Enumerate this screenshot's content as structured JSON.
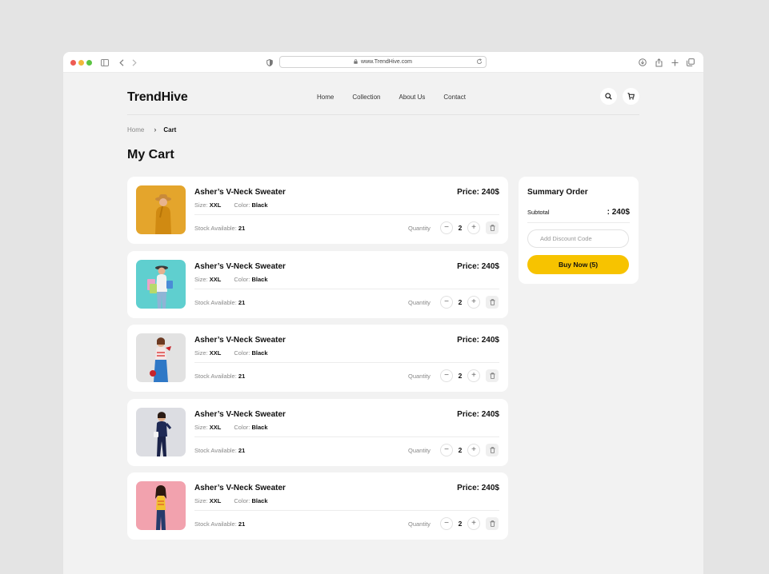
{
  "browser": {
    "url": "www.TrendHive.com"
  },
  "site": {
    "logo": "TrendHive",
    "nav": [
      {
        "label": "Home"
      },
      {
        "label": "Collection"
      },
      {
        "label": "About Us"
      },
      {
        "label": "Contact"
      }
    ]
  },
  "breadcrumb": {
    "home": "Home",
    "current": "Cart"
  },
  "page": {
    "title": "My Cart"
  },
  "cart": {
    "items": [
      {
        "name": "Asher’s V-Neck Sweater",
        "price": "Price: 240$",
        "size_label": "Size:",
        "size": "XXL",
        "color_label": "Color:",
        "color": "Black",
        "stock_label": "Stock Available:",
        "stock": "21",
        "quantity_label": "Quantity",
        "quantity": "2",
        "image_bg": "#e4a52c"
      },
      {
        "name": "Asher’s V-Neck Sweater",
        "price": "Price: 240$",
        "size_label": "Size:",
        "size": "XXL",
        "color_label": "Color:",
        "color": "Black",
        "stock_label": "Stock Available:",
        "stock": "21",
        "quantity_label": "Quantity",
        "quantity": "2",
        "image_bg": "#5fcfcf"
      },
      {
        "name": "Asher’s V-Neck Sweater",
        "price": "Price: 240$",
        "size_label": "Size:",
        "size": "XXL",
        "color_label": "Color:",
        "color": "Black",
        "stock_label": "Stock Available:",
        "stock": "21",
        "quantity_label": "Quantity",
        "quantity": "2",
        "image_bg": "#e2e2e2"
      },
      {
        "name": "Asher’s V-Neck Sweater",
        "price": "Price: 240$",
        "size_label": "Size:",
        "size": "XXL",
        "color_label": "Color:",
        "color": "Black",
        "stock_label": "Stock Available:",
        "stock": "21",
        "quantity_label": "Quantity",
        "quantity": "2",
        "image_bg": "#dcdde2"
      },
      {
        "name": "Asher’s V-Neck Sweater",
        "price": "Price: 240$",
        "size_label": "Size:",
        "size": "XXL",
        "color_label": "Color:",
        "color": "Black",
        "stock_label": "Stock Available:",
        "stock": "21",
        "quantity_label": "Quantity",
        "quantity": "2",
        "image_bg": "#f2a2ae"
      }
    ]
  },
  "summary": {
    "title": "Summary Order",
    "subtotal_label": "Subtotal",
    "subtotal_value": ": 240$",
    "discount_placeholder": "Add Discount Code",
    "buy_label": "Buy Now (5)"
  },
  "colors": {
    "accent": "#f7c300",
    "background": "#f2f2f2",
    "card": "#ffffff"
  }
}
